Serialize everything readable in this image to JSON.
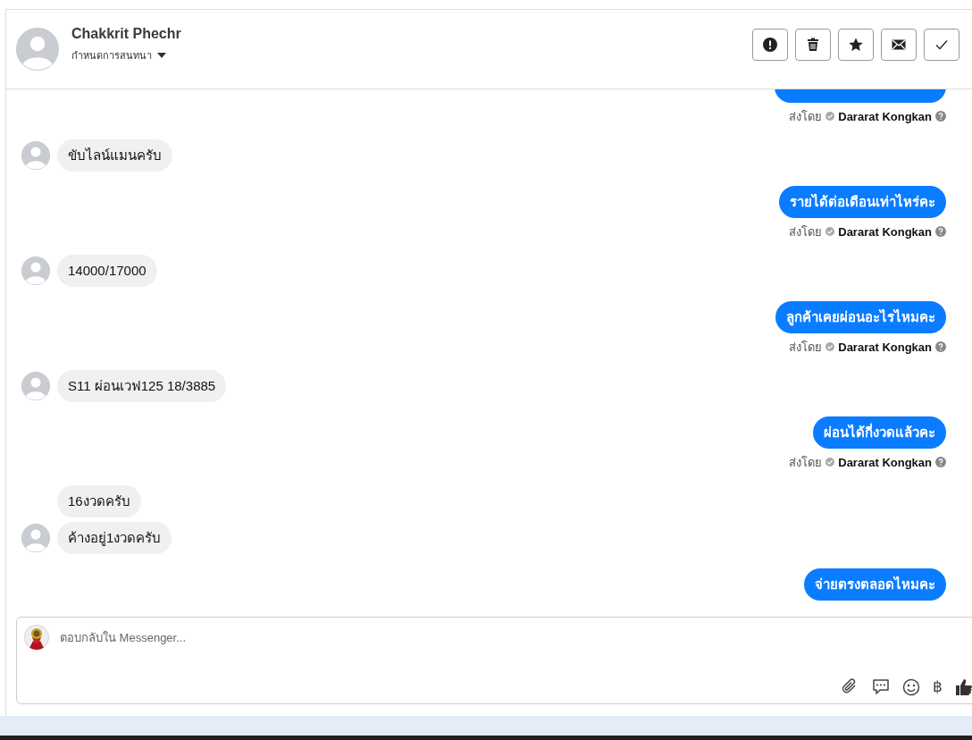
{
  "header": {
    "name": "Chakkrit Phechr",
    "subtitle": "กำหนดการสนทนา",
    "actions": [
      {
        "kind": "alert"
      },
      {
        "kind": "trash"
      },
      {
        "kind": "star"
      },
      {
        "kind": "mail"
      },
      {
        "kind": "check"
      }
    ]
  },
  "messages": [
    {
      "kind": "outgoing",
      "sender_label": "ส่งโดย",
      "sender": "Dararat Kongkan"
    },
    {
      "kind": "incoming",
      "text": "ขับไลน์แมนครับ",
      "avatar": true
    },
    {
      "kind": "outgoing",
      "text": "รายได้ต่อเดือนเท่าไหร่คะ",
      "sender_label": "ส่งโดย",
      "sender": "Dararat Kongkan"
    },
    {
      "kind": "incoming",
      "text": "14000/17000",
      "avatar": true
    },
    {
      "kind": "outgoing",
      "text": "ลูกค้าเคยผ่อนอะไรไหมคะ",
      "sender_label": "ส่งโดย",
      "sender": "Dararat Kongkan"
    },
    {
      "kind": "incoming",
      "text": "S11 ผ่อนเวฟ125 18/3885",
      "avatar": true
    },
    {
      "kind": "outgoing",
      "text": "ผ่อนได้กี่งวดแล้วคะ",
      "sender_label": "ส่งโดย",
      "sender": "Dararat Kongkan"
    },
    {
      "kind": "incoming",
      "text": "16งวดครับ",
      "avatar": false
    },
    {
      "kind": "incoming",
      "text": "ค้างอยู่1งวดครับ",
      "avatar": true
    },
    {
      "kind": "outgoing",
      "text": "จ่ายตรงตลอดไหมคะ"
    }
  ],
  "composer": {
    "placeholder": "ตอบกลับใน Messenger...",
    "tools": [
      {
        "kind": "attach"
      },
      {
        "kind": "comment"
      },
      {
        "kind": "emoji"
      },
      {
        "kind": "text",
        "label": "฿"
      },
      {
        "kind": "like"
      }
    ]
  }
}
